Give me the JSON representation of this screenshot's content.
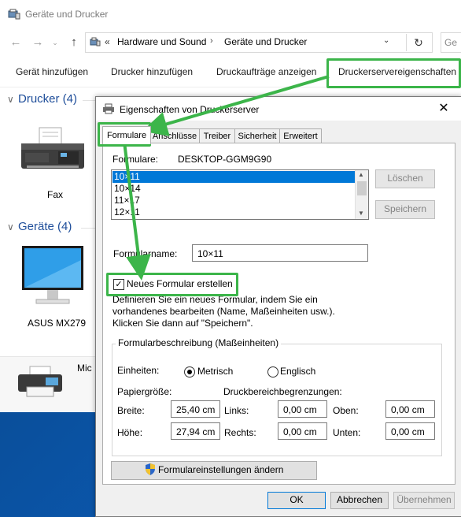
{
  "explorer": {
    "title": "Geräte und Drucker",
    "address_crumbs": [
      "Hardware und Sound",
      "Geräte und Drucker"
    ],
    "address_sep": "«",
    "search_placeholder": "Ge",
    "commands": [
      "Gerät hinzufügen",
      "Drucker hinzufügen",
      "Druckaufträge anzeigen",
      "Druckerservereigenschaften"
    ],
    "groups": [
      {
        "title": "Drucker (4)",
        "devices": [
          {
            "label": "Fax",
            "icon": "fax-icon"
          }
        ]
      },
      {
        "title": "Geräte (4)",
        "devices": [
          {
            "label": "ASUS MX279",
            "icon": "monitor-icon"
          }
        ]
      }
    ],
    "partial_device_label": "Mic"
  },
  "dialog": {
    "title": "Eigenschaften von Druckerserver",
    "tabs": [
      "Formulare",
      "Anschlüsse",
      "Treiber",
      "Sicherheit",
      "Erweitert"
    ],
    "forms_label": "Formulare:",
    "server_name": "DESKTOP-GGM9G90",
    "forms_list": [
      "10×11",
      "10×14",
      "11×17",
      "12×11"
    ],
    "selected_index": 0,
    "delete_button": "Löschen",
    "save_button": "Speichern",
    "form_name_label": "Formularname:",
    "form_name_value": "10×11",
    "new_form_checkbox": "Neues Formular erstellen",
    "new_form_checked": true,
    "description_lines": [
      "Definieren Sie ein neues Formular, indem Sie ein",
      "vorhandenes bearbeiten (Name, Maßeinheiten usw.).",
      "Klicken Sie dann auf \"Speichern\"."
    ],
    "fieldset_legend": "Formularbeschreibung (Maßeinheiten)",
    "units_label": "Einheiten:",
    "unit_metric": "Metrisch",
    "unit_english": "Englisch",
    "unit_selected": "Metrisch",
    "paper_size_label": "Papiergröße:",
    "print_area_label": "Druckbereichbegrenzungen:",
    "width_label": "Breite:",
    "width_value": "25,40 cm",
    "height_label": "Höhe:",
    "height_value": "27,94 cm",
    "left_label": "Links:",
    "left_value": "0,00 cm",
    "right_label": "Rechts:",
    "right_value": "0,00 cm",
    "top_label": "Oben:",
    "top_value": "0,00 cm",
    "bottom_label": "Unten:",
    "bottom_value": "0,00 cm",
    "change_settings_button": "Formulareinstellungen ändern",
    "ok_button": "OK",
    "cancel_button": "Abbrechen",
    "apply_button": "Übernehmen"
  },
  "colors": {
    "highlight_green": "#3cb54a",
    "selection_blue": "#0078d7",
    "group_title": "#1f4e9a"
  }
}
